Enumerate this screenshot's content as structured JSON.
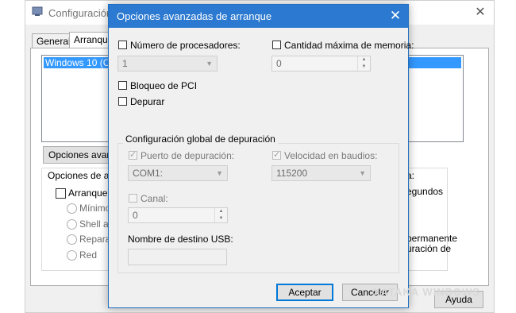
{
  "background_window": {
    "title": "Configuración",
    "tabs": [
      "General",
      "Arranque"
    ],
    "list_item": "Windows 10 (C:\\",
    "options_button": "Opciones avanza",
    "group_label": "Opciones de arr",
    "safe_boot_label": "Arranque a",
    "radios": [
      "Mínimo",
      "Shell alt",
      "Reparar",
      "Red"
    ],
    "right_text": {
      "colon": "a:",
      "seconds": "egundos",
      "permanent": "permanente",
      "config_de": "uración de"
    },
    "help_button": "Ayuda"
  },
  "dialog": {
    "title": "Opciones avanzadas de arranque",
    "close_glyph": "✕",
    "num_processors": {
      "label": "Número de procesadores:",
      "value": "1"
    },
    "max_memory": {
      "label": "Cantidad máxima de memoria:",
      "value": "0"
    },
    "pci_lock_label": "Bloqueo de PCI",
    "debug_label": "Depurar",
    "debug_settings": {
      "group_label": "Configuración global de depuración",
      "debug_port": {
        "label": "Puerto de depuración:",
        "value": "COM1:"
      },
      "baud_rate": {
        "label": "Velocidad en baudios:",
        "value": "115200"
      },
      "channel": {
        "label": "Canal:",
        "value": "0"
      },
      "usb_target_label": "Nombre de destino USB:",
      "usb_target_value": ""
    },
    "ok_button": "Aceptar",
    "cancel_button": "Cancelar"
  },
  "watermark": "XATAKA WINDOWS"
}
